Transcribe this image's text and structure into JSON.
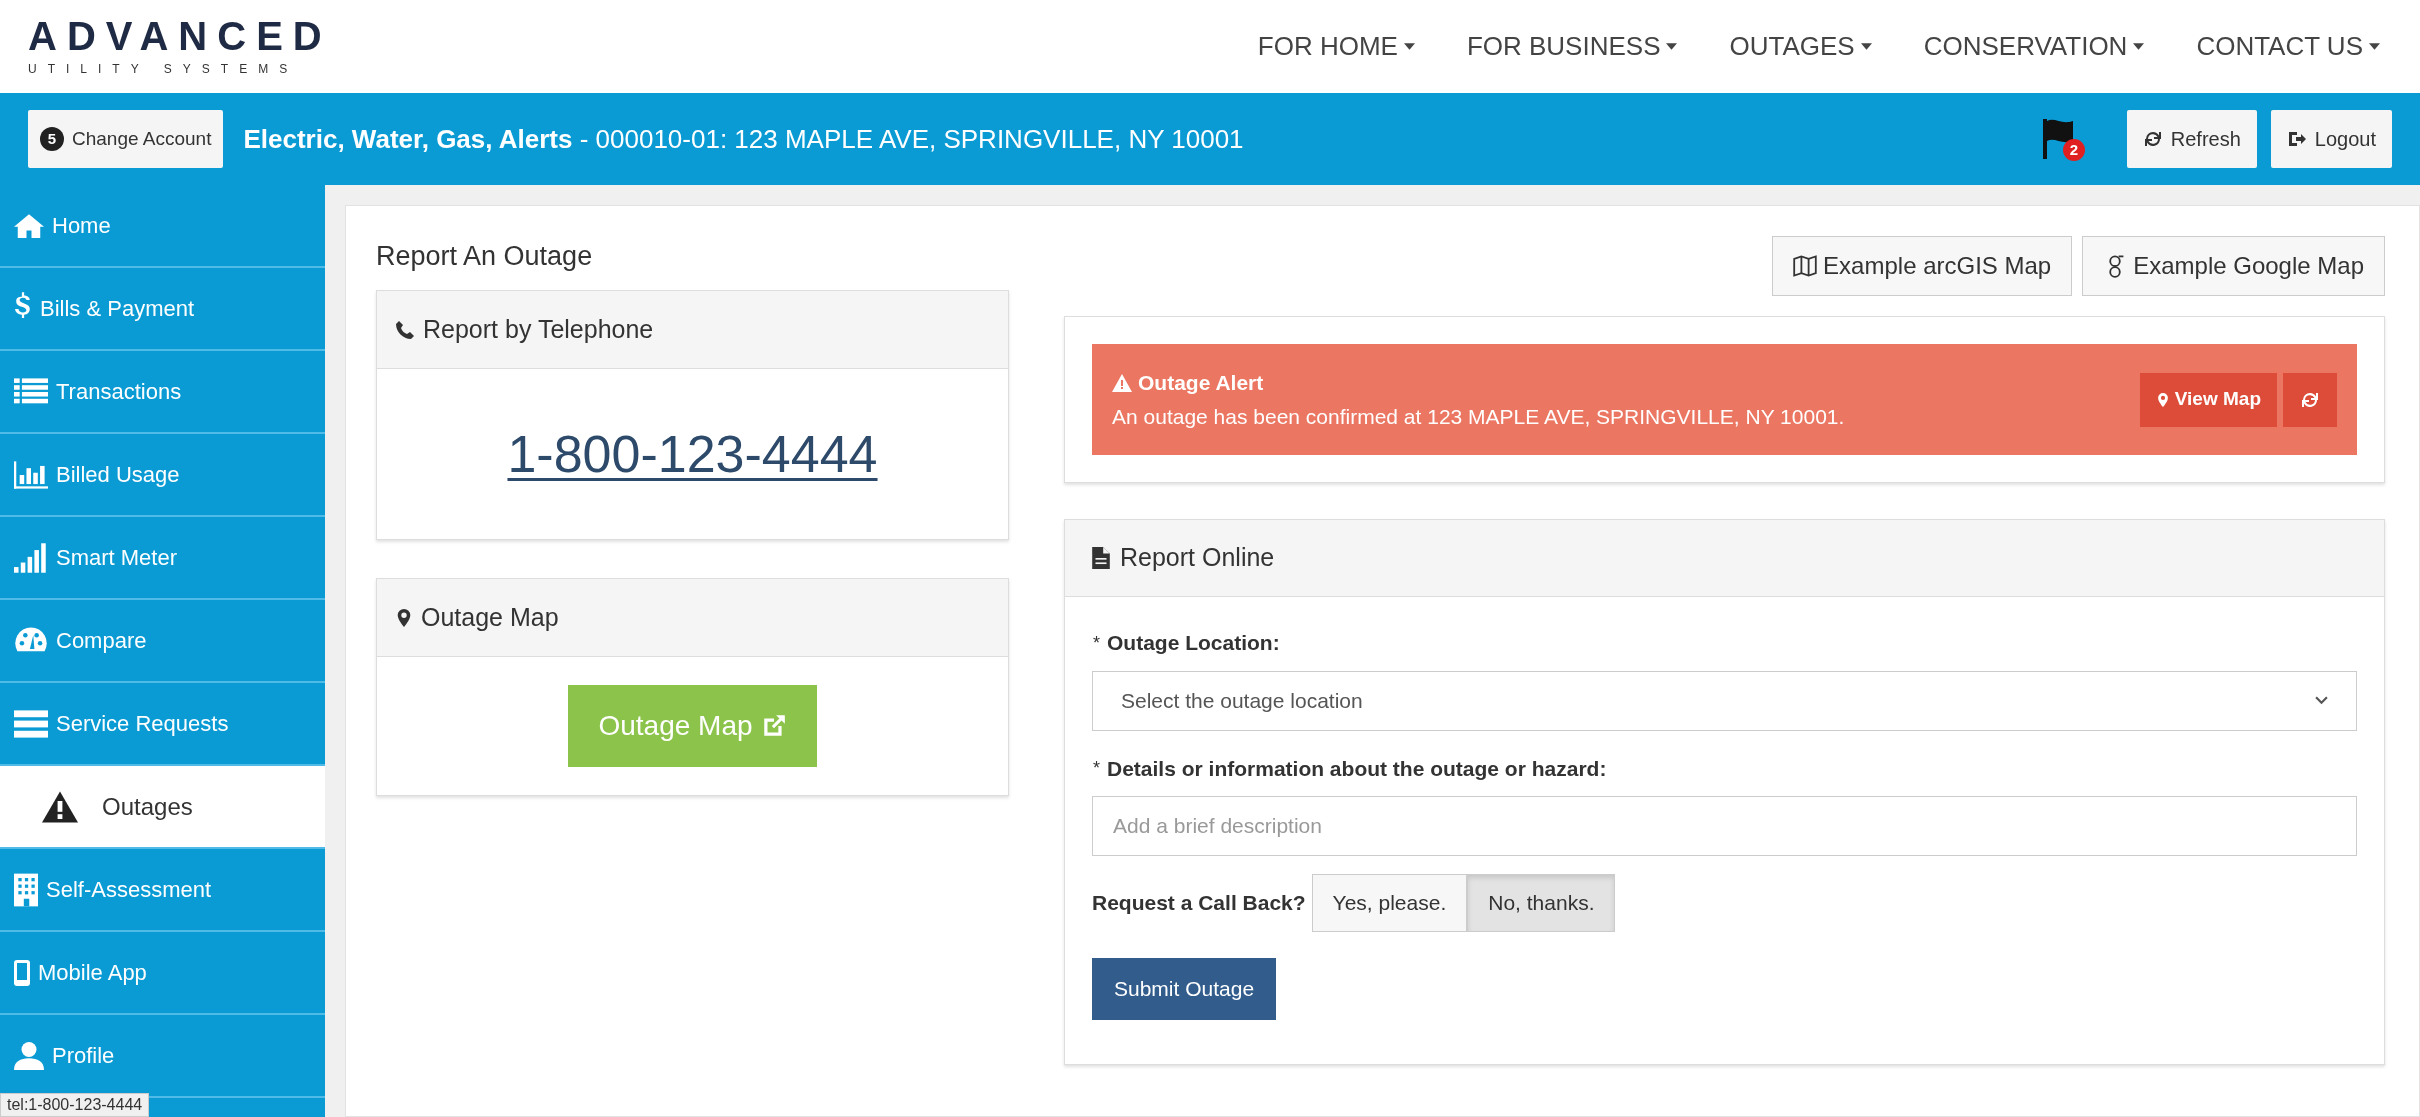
{
  "logo": {
    "name": "ADVANCED",
    "tagline": "UTILITY SYSTEMS"
  },
  "nav": [
    "FOR HOME",
    "FOR BUSINESS",
    "OUTAGES",
    "CONSERVATION",
    "CONTACT US"
  ],
  "account_bar": {
    "badge": "5",
    "change_account": "Change Account",
    "services": "Electric, Water, Gas, Alerts",
    "account": " - 000010-01: 123 MAPLE AVE, SPRINGVILLE, NY 10001",
    "flag_count": "2",
    "refresh": "Refresh",
    "logout": "Logout"
  },
  "sidebar": {
    "items": [
      {
        "label": "Home",
        "selected": false
      },
      {
        "label": "Bills & Payment",
        "selected": false
      },
      {
        "label": "Transactions",
        "selected": false
      },
      {
        "label": "Billed Usage",
        "selected": false
      },
      {
        "label": "Smart Meter",
        "selected": false
      },
      {
        "label": "Compare",
        "selected": false
      },
      {
        "label": "Service Requests",
        "selected": false
      },
      {
        "label": "Outages",
        "selected": true
      },
      {
        "label": "Self-Assessment",
        "selected": false
      },
      {
        "label": "Mobile App",
        "selected": false
      },
      {
        "label": "Profile",
        "selected": false
      }
    ]
  },
  "page_title": "Report An Outage",
  "telephone_panel": {
    "title": "Report by Telephone",
    "number": "1-800-123-4444"
  },
  "map_panel": {
    "title": "Outage Map",
    "button": "Outage Map"
  },
  "map_buttons": [
    "Example arcGIS Map",
    "Example Google Map"
  ],
  "alert": {
    "title": "Outage Alert",
    "message": "An outage has been confirmed at 123 MAPLE AVE, SPRINGVILLE, NY 10001.",
    "view_map": "View Map"
  },
  "report_online": {
    "title": "Report Online",
    "location_required": "*",
    "location_label": "Outage Location:",
    "location_placeholder": "Select the outage location",
    "details_required": "*",
    "details_label": "Details or information about the outage or hazard:",
    "details_placeholder": "Add a brief description",
    "callback_label": "Request a Call Back?",
    "callback_options": [
      {
        "label": "Yes, please.",
        "selected": false
      },
      {
        "label": "No, thanks.",
        "selected": true
      }
    ],
    "submit": "Submit Outage"
  },
  "status_bar": "tel:1-800-123-4444"
}
